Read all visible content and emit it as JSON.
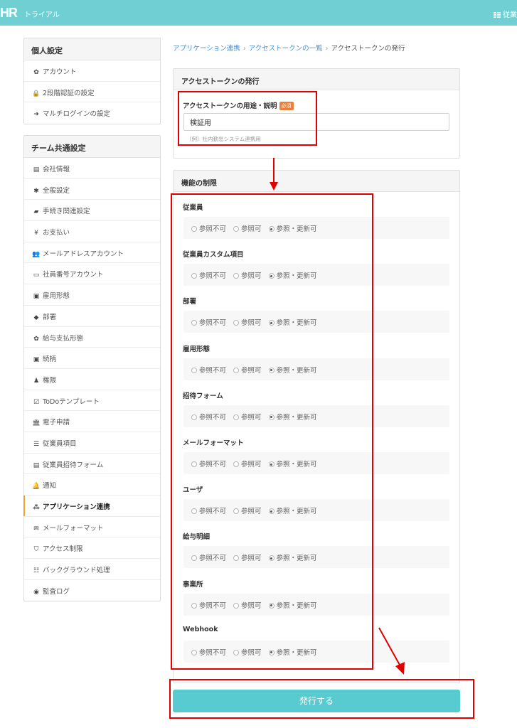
{
  "topbar": {
    "brand": "HR",
    "plan": "トライアル",
    "right_label": "従業"
  },
  "sidebar": {
    "personal": {
      "title": "個人設定",
      "items": [
        {
          "icon": "gear-icon",
          "glyph": "✿",
          "label": "アカウント"
        },
        {
          "icon": "lock-icon",
          "glyph": "🔒",
          "label": "2段階認証の設定"
        },
        {
          "icon": "sign-in-icon",
          "glyph": "➜",
          "label": "マルチログインの設定"
        }
      ]
    },
    "team": {
      "title": "チーム共通設定",
      "items": [
        {
          "icon": "building-icon",
          "glyph": "▤",
          "label": "会社情報"
        },
        {
          "icon": "asterisk-icon",
          "glyph": "✱",
          "label": "全般設定"
        },
        {
          "icon": "book-icon",
          "glyph": "▰",
          "label": "手続き関連設定"
        },
        {
          "icon": "yen-icon",
          "glyph": "¥",
          "label": "お支払い"
        },
        {
          "icon": "users-icon",
          "glyph": "👥",
          "label": "メールアドレスアカウント"
        },
        {
          "icon": "id-card-icon",
          "glyph": "▭",
          "label": "社員番号アカウント"
        },
        {
          "icon": "badge-icon",
          "glyph": "▣",
          "label": "雇用形態"
        },
        {
          "icon": "tags-icon",
          "glyph": "◆",
          "label": "部署"
        },
        {
          "icon": "cog-icon",
          "glyph": "✿",
          "label": "給与支払形態"
        },
        {
          "icon": "portrait-icon",
          "glyph": "▣",
          "label": "続柄"
        },
        {
          "icon": "user-key-icon",
          "glyph": "♟",
          "label": "権限"
        },
        {
          "icon": "check-square-icon",
          "glyph": "☑",
          "label": "ToDoテンプレート"
        },
        {
          "icon": "bank-icon",
          "glyph": "🏛",
          "label": "電子申請"
        },
        {
          "icon": "list-icon",
          "glyph": "☰",
          "label": "従業員項目"
        },
        {
          "icon": "form-icon",
          "glyph": "▤",
          "label": "従業員招待フォーム"
        },
        {
          "icon": "bell-icon",
          "glyph": "🔔",
          "label": "通知"
        },
        {
          "icon": "cubes-icon",
          "glyph": "⁂",
          "label": "アプリケーション連携",
          "active": true
        },
        {
          "icon": "envelope-icon",
          "glyph": "✉",
          "label": "メールフォーマット"
        },
        {
          "icon": "shield-icon",
          "glyph": "⛉",
          "label": "アクセス制限"
        },
        {
          "icon": "tasks-icon",
          "glyph": "☷",
          "label": "バックグラウンド処理"
        },
        {
          "icon": "eye-icon",
          "glyph": "◉",
          "label": "監査ログ"
        }
      ]
    }
  },
  "breadcrumb": {
    "item1": "アプリケーション連携",
    "item2": "アクセストークンの一覧",
    "current": "アクセストークンの発行",
    "separator": "›"
  },
  "token_panel": {
    "title": "アクセストークンの発行",
    "field_label": "アクセストークンの用途・説明",
    "required_badge": "必須",
    "value": "検証用",
    "hint": "（例）社内勤怠システム連携用"
  },
  "permissions": {
    "title": "機能の制限",
    "options": [
      "参照不可",
      "参照可",
      "参照・更新可"
    ],
    "items": [
      {
        "label": "従業員",
        "selected": "参照・更新可"
      },
      {
        "label": "従業員カスタム項目",
        "selected": "参照・更新可"
      },
      {
        "label": "部署",
        "selected": "参照・更新可"
      },
      {
        "label": "雇用形態",
        "selected": "参照・更新可"
      },
      {
        "label": "招待フォーム",
        "selected": "参照・更新可"
      },
      {
        "label": "メールフォーマット",
        "selected": "参照・更新可"
      },
      {
        "label": "ユーザ",
        "selected": "参照・更新可"
      },
      {
        "label": "給与明細",
        "selected": "参照・更新可"
      },
      {
        "label": "事業所",
        "selected": "参照・更新可"
      },
      {
        "label": "Webhook",
        "selected": "参照・更新可"
      }
    ]
  },
  "submit_label": "発行する",
  "annotation_color": "#e00000"
}
